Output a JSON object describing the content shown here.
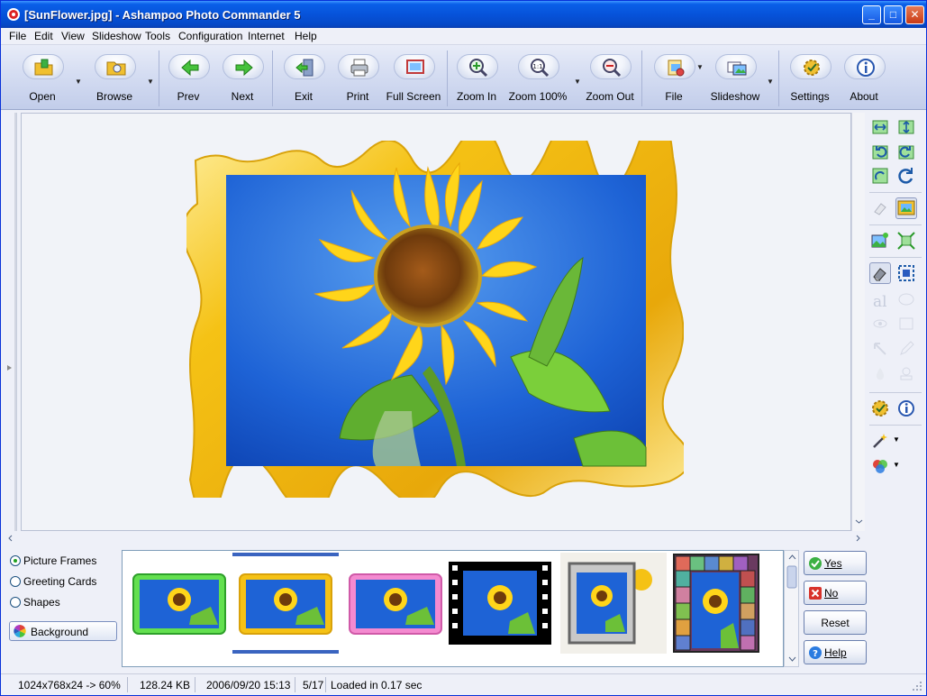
{
  "window": {
    "title": "[SunFlower.jpg] - Ashampoo Photo Commander 5",
    "controls": {
      "minimize": "_",
      "maximize": "□",
      "close": "✕"
    }
  },
  "menu": [
    "File",
    "Edit",
    "View",
    "Slideshow",
    "Tools",
    "Configuration",
    "Internet",
    "Help"
  ],
  "toolbar": {
    "open": "Open",
    "browse": "Browse",
    "prev": "Prev",
    "next": "Next",
    "exit": "Exit",
    "print": "Print",
    "fullscreen": "Full Screen",
    "zoom_in": "Zoom In",
    "zoom_100": "Zoom 100%",
    "zoom_out": "Zoom Out",
    "file": "File",
    "slideshow": "Slideshow",
    "settings": "Settings",
    "about": "About"
  },
  "options": {
    "picture_frames": "Picture Frames",
    "greeting_cards": "Greeting Cards",
    "shapes": "Shapes",
    "background": "Background",
    "selected": "Picture Frames"
  },
  "actions": {
    "yes": "Yes",
    "no": "No",
    "reset": "Reset",
    "help": "Help"
  },
  "status": {
    "dimensions": "1024x768x24 -> 60%",
    "size": "128.24 KB",
    "date": "2006/09/20 15:13",
    "index": "5/17",
    "load": "Loaded in 0.17 sec"
  },
  "colors": {
    "title_bar": "#0653da",
    "frame_gold": "#f5c215",
    "sky_blue": "#1e63d6",
    "petal_yellow": "#ffd51a"
  },
  "thumbnails": [
    {
      "frame": "green"
    },
    {
      "frame": "gold",
      "selected": true
    },
    {
      "frame": "pink"
    },
    {
      "frame": "film"
    },
    {
      "frame": "silver"
    },
    {
      "frame": "stained-glass"
    }
  ]
}
